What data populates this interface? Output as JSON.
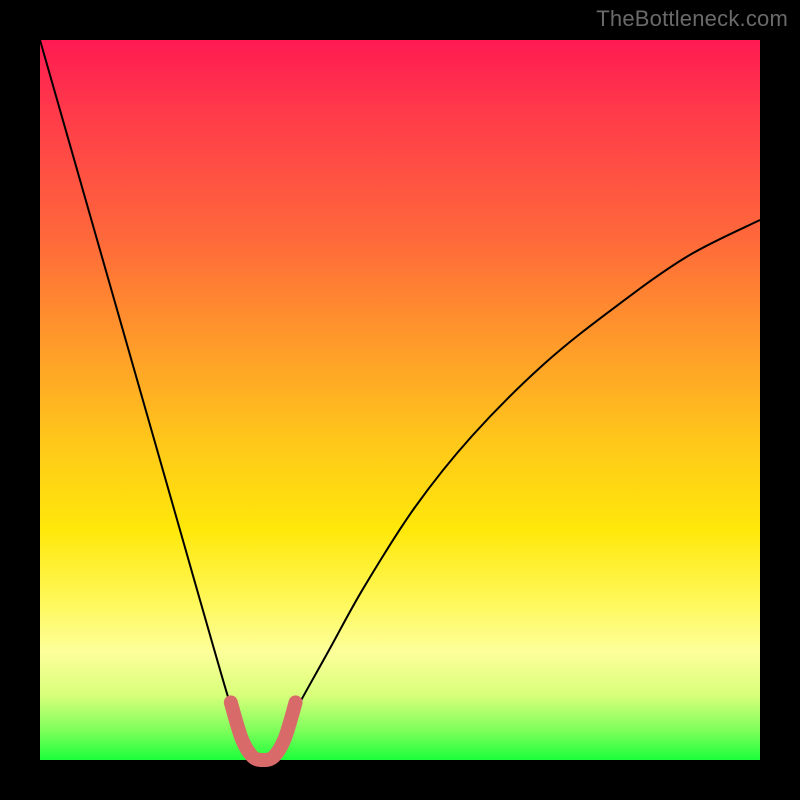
{
  "watermark": "TheBottleneck.com",
  "chart_data": {
    "type": "line",
    "title": "",
    "xlabel": "",
    "ylabel": "",
    "xlim": [
      0,
      100
    ],
    "ylim": [
      0,
      100
    ],
    "grid": false,
    "legend": null,
    "series": [
      {
        "name": "bottleneck-curve",
        "color": "#000000",
        "stroke_width": 2,
        "x": [
          0,
          4,
          8,
          12,
          16,
          20,
          24,
          27,
          29,
          31,
          33,
          35,
          40,
          45,
          52,
          60,
          70,
          80,
          90,
          100
        ],
        "y": [
          100,
          86,
          72,
          58,
          44,
          30,
          16,
          6,
          2,
          0,
          2,
          6,
          15,
          24,
          35,
          45,
          55,
          63,
          70,
          75
        ]
      },
      {
        "name": "highlight-valley",
        "color": "#d86a6a",
        "stroke_width": 14,
        "linecap": "round",
        "x": [
          26.5,
          28,
          29.5,
          31,
          32.5,
          34,
          35.5
        ],
        "y": [
          8,
          3,
          0.5,
          0,
          0.5,
          3,
          8
        ]
      }
    ],
    "annotations": []
  }
}
